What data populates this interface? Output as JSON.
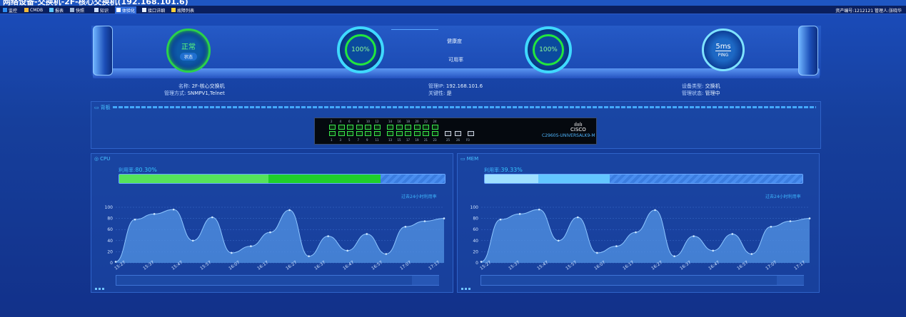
{
  "window": {
    "title": "网络设备-交换机-2F-核心交换机(192.168.101.6)"
  },
  "nav": {
    "items": [
      {
        "label": "监控",
        "icon": "monitor-icon"
      },
      {
        "label": "CMDB",
        "icon": "cmdb-icon"
      },
      {
        "label": "报表",
        "icon": "report-icon"
      },
      {
        "label": "快照",
        "icon": "snapshot-icon"
      },
      {
        "label": "知识",
        "icon": "knowledge-icon"
      },
      {
        "label": "体验化",
        "icon": "experience-icon"
      },
      {
        "label": "接口详细",
        "icon": "interface-icon"
      },
      {
        "label": "故障列表",
        "icon": "alert-icon"
      }
    ],
    "asset_no": "资产编号:1212121",
    "manager": "管理人:张晓华"
  },
  "status": {
    "value": "正常",
    "label": "状态"
  },
  "health": {
    "value": "100%",
    "label": "健康度"
  },
  "availability": {
    "value": "100%",
    "label": "可用率"
  },
  "ping": {
    "value": "5ms",
    "label": "PING"
  },
  "device": {
    "name_key": "名称:",
    "name": "2F-核心交换机",
    "mgmt_key": "管理方式:",
    "mgmt": "SNMPV1,Telnet",
    "ip_key": "管理IP:",
    "ip": "192.168.101.6",
    "key_key": "关键性:",
    "key": "是",
    "type_key": "设备类型:",
    "type": "交换机",
    "state_key": "管理状态:",
    "state": "管理中"
  },
  "backplane": {
    "title": "背板",
    "brand_line1": "ılıılı",
    "brand_line2": "CISCO",
    "model": "C2960S-UNIVERSALK9-M",
    "top_port_numbers": [
      "2",
      "4",
      "6",
      "8",
      "10",
      "12",
      "14",
      "16",
      "18",
      "20",
      "22",
      "24"
    ],
    "bottom_port_numbers": [
      "1",
      "3",
      "5",
      "7",
      "9",
      "11",
      "13",
      "15",
      "17",
      "19",
      "21",
      "23",
      "25",
      "26",
      "F0"
    ]
  },
  "cpu": {
    "title": "CPU",
    "util_label": "利用率:",
    "util_value": "80.30%",
    "util_fraction": 0.803,
    "past24": "过去24小时利用率"
  },
  "mem": {
    "title": "MEM",
    "util_label": "利用率:",
    "util_value": "39.33%",
    "util_fraction": 0.3933,
    "past24": "过去24小时利用率"
  },
  "chart_data": [
    {
      "type": "area",
      "name": "CPU",
      "x": [
        "15:27",
        "15:37",
        "15:47",
        "15:57",
        "16:07",
        "16:17",
        "16:27",
        "16:37",
        "16:47",
        "16:57",
        "17:07",
        "17:17"
      ],
      "values": [
        2,
        78,
        88,
        96,
        40,
        82,
        18,
        30,
        55,
        95,
        12,
        48,
        22,
        52,
        16,
        65,
        75,
        80
      ],
      "ylim": [
        0,
        100
      ],
      "yticks": [
        "0",
        "20",
        "40",
        "60",
        "80",
        "100"
      ],
      "grid": true
    },
    {
      "type": "area",
      "name": "MEM",
      "x": [
        "15:27",
        "15:37",
        "15:47",
        "15:57",
        "16:07",
        "16:17",
        "16:27",
        "16:37",
        "16:47",
        "16:57",
        "17:07",
        "17:17"
      ],
      "values": [
        2,
        78,
        88,
        96,
        40,
        82,
        18,
        30,
        55,
        95,
        12,
        48,
        22,
        52,
        16,
        65,
        75,
        80
      ],
      "ylim": [
        0,
        100
      ],
      "yticks": [
        "0",
        "20",
        "40",
        "60",
        "80",
        "100"
      ],
      "grid": true
    }
  ]
}
